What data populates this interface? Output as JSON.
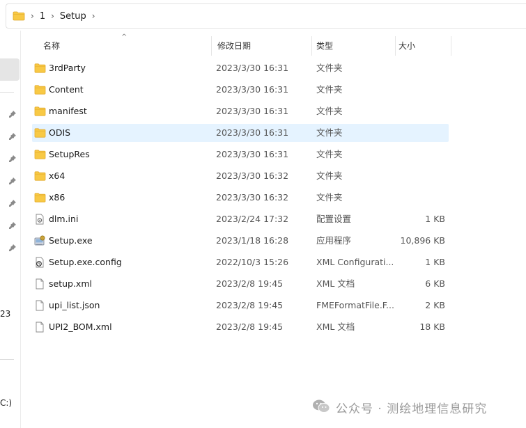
{
  "breadcrumb": {
    "icon": "folder-icon",
    "items": [
      "1",
      "Setup"
    ]
  },
  "columns": {
    "name": "名称",
    "date": "修改日期",
    "type": "类型",
    "size": "大小"
  },
  "nav": {
    "trunc_23": "23",
    "trunc_c": "C:)"
  },
  "files": [
    {
      "icon": "folder-icon",
      "name": "3rdParty",
      "date": "2023/3/30 16:31",
      "type": "文件夹",
      "size": ""
    },
    {
      "icon": "folder-icon",
      "name": "Content",
      "date": "2023/3/30 16:31",
      "type": "文件夹",
      "size": ""
    },
    {
      "icon": "folder-icon",
      "name": "manifest",
      "date": "2023/3/30 16:31",
      "type": "文件夹",
      "size": ""
    },
    {
      "icon": "folder-icon",
      "name": "ODIS",
      "date": "2023/3/30 16:31",
      "type": "文件夹",
      "size": "",
      "selected": true
    },
    {
      "icon": "folder-icon",
      "name": "SetupRes",
      "date": "2023/3/30 16:31",
      "type": "文件夹",
      "size": ""
    },
    {
      "icon": "folder-icon",
      "name": "x64",
      "date": "2023/3/30 16:32",
      "type": "文件夹",
      "size": ""
    },
    {
      "icon": "folder-icon",
      "name": "x86",
      "date": "2023/3/30 16:32",
      "type": "文件夹",
      "size": ""
    },
    {
      "icon": "settings-file-icon",
      "name": "dlm.ini",
      "date": "2023/2/24 17:32",
      "type": "配置设置",
      "size": "1 KB"
    },
    {
      "icon": "installer-exe-icon",
      "name": "Setup.exe",
      "date": "2023/1/18 16:28",
      "type": "应用程序",
      "size": "10,896 KB"
    },
    {
      "icon": "config-file-icon",
      "name": "Setup.exe.config",
      "date": "2022/10/3 15:26",
      "type": "XML Configurati...",
      "size": "1 KB"
    },
    {
      "icon": "document-icon",
      "name": "setup.xml",
      "date": "2023/2/8 19:45",
      "type": "XML 文档",
      "size": "6 KB"
    },
    {
      "icon": "document-icon",
      "name": "upi_list.json",
      "date": "2023/2/8 19:45",
      "type": "FMEFormatFile.F...",
      "size": "2 KB"
    },
    {
      "icon": "document-icon",
      "name": "UPI2_BOM.xml",
      "date": "2023/2/8 19:45",
      "type": "XML 文档",
      "size": "18 KB"
    }
  ],
  "watermark": {
    "icon": "wechat-icon",
    "text": "公众号 · 测绘地理信息研究"
  },
  "colors": {
    "folder": "#f8c945",
    "selection": "#e5f3ff"
  }
}
